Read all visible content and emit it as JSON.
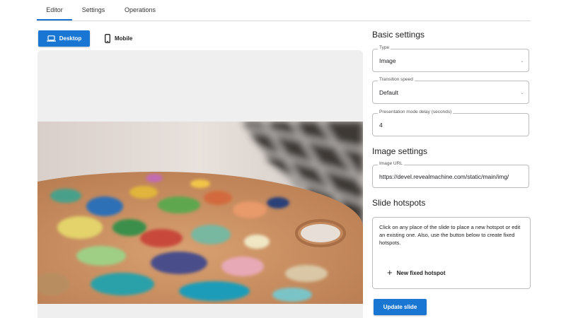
{
  "tabs": [
    {
      "label": "Editor",
      "active": true
    },
    {
      "label": "Settings",
      "active": false
    },
    {
      "label": "Operations",
      "active": false
    }
  ],
  "device_toggle": {
    "desktop_label": "Desktop",
    "mobile_label": "Mobile",
    "selected": "Desktop"
  },
  "basic_settings": {
    "heading": "Basic settings",
    "type": {
      "label": "Type",
      "value": "Image"
    },
    "transition_speed": {
      "label": "Transition speed",
      "value": "Default"
    },
    "presentation_delay": {
      "label": "Presentation mode delay (seconds)",
      "value": "4"
    }
  },
  "image_settings": {
    "heading": "Image settings",
    "image_url": {
      "label": "Image URL",
      "value": "https://devel.revealmachine.com/static/main/img/"
    }
  },
  "slide_hotspots": {
    "heading": "Slide hotspots",
    "help_text": "Click on any place of the slide to place a new hotspot or edit an existing one. Also, use the button below to create fixed hotspots.",
    "add_label": "New fixed hotspot"
  },
  "update_button_label": "Update slide",
  "colors": {
    "accent": "#1976d2"
  }
}
